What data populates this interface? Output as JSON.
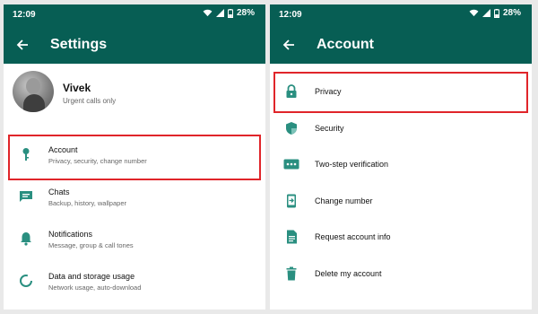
{
  "status": {
    "time": "12:09",
    "battery": "28%"
  },
  "left": {
    "title": "Settings",
    "profile": {
      "name": "Vivek",
      "status": "Urgent calls only"
    },
    "items": [
      {
        "label": "Account",
        "sub": "Privacy, security, change number",
        "icon": "key-icon"
      },
      {
        "label": "Chats",
        "sub": "Backup, history, wallpaper",
        "icon": "chat-icon"
      },
      {
        "label": "Notifications",
        "sub": "Message, group & call tones",
        "icon": "bell-icon"
      },
      {
        "label": "Data and storage usage",
        "sub": "Network usage, auto-download",
        "icon": "data-usage-icon"
      }
    ]
  },
  "right": {
    "title": "Account",
    "items": [
      {
        "label": "Privacy",
        "icon": "lock-icon"
      },
      {
        "label": "Security",
        "icon": "shield-icon"
      },
      {
        "label": "Two-step verification",
        "icon": "dots-icon"
      },
      {
        "label": "Change number",
        "icon": "change-number-icon"
      },
      {
        "label": "Request account info",
        "icon": "document-icon"
      },
      {
        "label": "Delete my account",
        "icon": "trash-icon"
      }
    ]
  },
  "colors": {
    "header": "#075e54",
    "icon": "#2a8f80",
    "highlight": "#e0252a"
  }
}
